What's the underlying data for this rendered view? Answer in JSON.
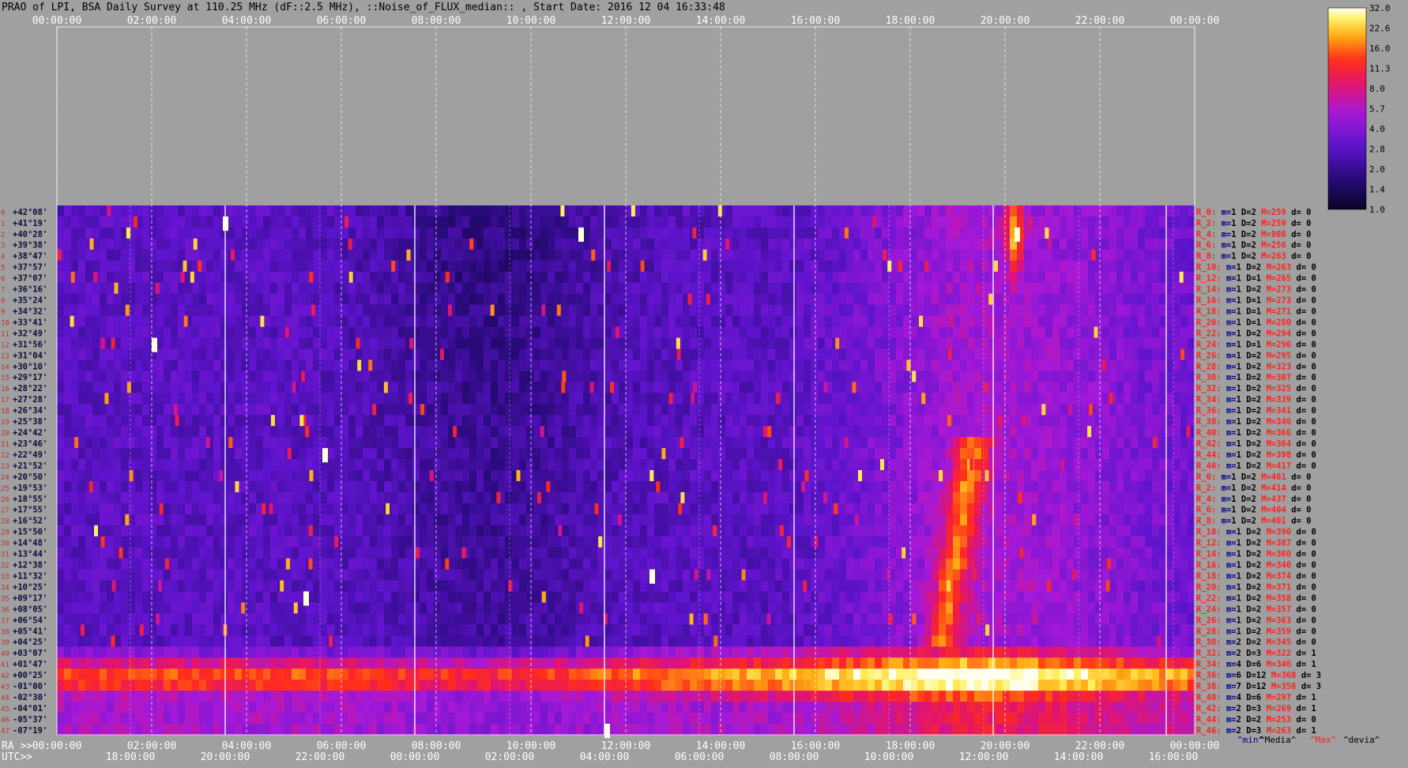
{
  "title": "PRAO of LPI, BSA Daily Survey at 110.25 MHz (dF::2.5 MHz), ::Noise_of_FLUX_median:: , Start Date: 2016 12 04 16:33:48",
  "chart_data": {
    "type": "heatmap",
    "title": "PRAO of LPI, BSA Daily Survey at 110.25 MHz (dF::2.5 MHz), ::Noise_of_FLUX_median:: , Start Date: 2016 12 04 16:33:48",
    "ra_axis_label": "RA >>",
    "utc_axis_label": "UTC>>",
    "ra_ticks_top": [
      "00:00:00",
      "02:00:00",
      "04:00:00",
      "06:00:00",
      "08:00:00",
      "10:00:00",
      "12:00:00",
      "14:00:00",
      "16:00:00",
      "18:00:00",
      "20:00:00",
      "22:00:00",
      "00:00:00"
    ],
    "ra_ticks_bottom": [
      "00:00:00",
      "02:00:00",
      "04:00:00",
      "06:00:00",
      "08:00:00",
      "10:00:00",
      "12:00:00",
      "14:00:00",
      "16:00:00",
      "18:00:00",
      "20:00:00",
      "22:00:00",
      "00:00:00"
    ],
    "utc_ticks": [
      "18:00:00",
      "20:00:00",
      "22:00:00",
      "00:00:00",
      "02:00:00",
      "04:00:00",
      "06:00:00",
      "08:00:00",
      "10:00:00",
      "12:00:00",
      "14:00:00",
      "16:00:00"
    ],
    "row_numbers": [
      "0",
      "1",
      "2",
      "3",
      "4",
      "5",
      "6",
      "7",
      "8",
      "9",
      "10",
      "11",
      "12",
      "13",
      "14",
      "15",
      "16",
      "17",
      "18",
      "19",
      "20",
      "21",
      "22",
      "23",
      "24",
      "25",
      "26",
      "27",
      "28",
      "29",
      "30",
      "31",
      "32",
      "33",
      "34",
      "35",
      "36",
      "37",
      "38",
      "39",
      "40",
      "41",
      "42",
      "43",
      "44",
      "45",
      "46",
      "47",
      "0",
      "1",
      "2",
      "3",
      "4",
      "5",
      "6",
      "7",
      "8",
      "9",
      "10",
      "11",
      "12",
      "13",
      "14",
      "15",
      "16",
      "17",
      "18",
      "19",
      "20",
      "21",
      "22",
      "23",
      "24",
      "25",
      "26",
      "27",
      "28",
      "29",
      "30",
      "31",
      "32",
      "33",
      "34",
      "35",
      "36",
      "37",
      "38",
      "39",
      "40",
      "41",
      "42",
      "43",
      "44",
      "45",
      "46",
      "47"
    ],
    "declinations": [
      "+42°08'",
      "+41°19'",
      "+40°28'",
      "+39°38'",
      "+38°47'",
      "+37°57'",
      "+37°07'",
      "+36°16'",
      "+35°24'",
      "+34°32'",
      "+33°41'",
      "+32°49'",
      "+31°56'",
      "+31°04'",
      "+30°10'",
      "+29°17'",
      "+28°22'",
      "+27°28'",
      "+26°34'",
      "+25°38'",
      "+24°42'",
      "+23°46'",
      "+22°49'",
      "+21°52'",
      "+20°50'",
      "+19°53'",
      "+18°55'",
      "+17°55'",
      "+16°52'",
      "+15°50'",
      "+14°48'",
      "+13°44'",
      "+12°38'",
      "+11°32'",
      "+10°25'",
      "+09°17'",
      "+08°05'",
      "+06°54'",
      "+05°41'",
      "+04°25'",
      "+03°07'",
      "+01°47'",
      "+00°25'",
      "-01°00'",
      "-02°30'",
      "-04°01'",
      "-05°37'",
      "-07°19'"
    ],
    "beam_stats": [
      {
        "beam": "R_0:",
        "m": "1",
        "D": "2",
        "M": "259",
        "d": "0"
      },
      {
        "beam": "R_2:",
        "m": "1",
        "D": "2",
        "M": "259",
        "d": "0"
      },
      {
        "beam": "R_4:",
        "m": "1",
        "D": "2",
        "M": "908",
        "d": "0"
      },
      {
        "beam": "R_6:",
        "m": "1",
        "D": "2",
        "M": "256",
        "d": "0"
      },
      {
        "beam": "R_8:",
        "m": "1",
        "D": "2",
        "M": "263",
        "d": "0"
      },
      {
        "beam": "R_10:",
        "m": "1",
        "D": "2",
        "M": "263",
        "d": "0"
      },
      {
        "beam": "R_12:",
        "m": "1",
        "D": "1",
        "M": "265",
        "d": "0"
      },
      {
        "beam": "R_14:",
        "m": "1",
        "D": "2",
        "M": "273",
        "d": "0"
      },
      {
        "beam": "R_16:",
        "m": "1",
        "D": "1",
        "M": "273",
        "d": "0"
      },
      {
        "beam": "R_18:",
        "m": "1",
        "D": "1",
        "M": "271",
        "d": "0"
      },
      {
        "beam": "R_20:",
        "m": "1",
        "D": "1",
        "M": "280",
        "d": "0"
      },
      {
        "beam": "R_22:",
        "m": "1",
        "D": "2",
        "M": "294",
        "d": "0"
      },
      {
        "beam": "R_24:",
        "m": "1",
        "D": "1",
        "M": "296",
        "d": "0"
      },
      {
        "beam": "R_26:",
        "m": "1",
        "D": "2",
        "M": "295",
        "d": "0"
      },
      {
        "beam": "R_28:",
        "m": "1",
        "D": "2",
        "M": "323",
        "d": "0"
      },
      {
        "beam": "R_30:",
        "m": "1",
        "D": "2",
        "M": "307",
        "d": "0"
      },
      {
        "beam": "R_32:",
        "m": "1",
        "D": "2",
        "M": "325",
        "d": "0"
      },
      {
        "beam": "R_34:",
        "m": "1",
        "D": "2",
        "M": "339",
        "d": "0"
      },
      {
        "beam": "R_36:",
        "m": "1",
        "D": "2",
        "M": "341",
        "d": "0"
      },
      {
        "beam": "R_38:",
        "m": "1",
        "D": "2",
        "M": "346",
        "d": "0"
      },
      {
        "beam": "R_40:",
        "m": "1",
        "D": "2",
        "M": "366",
        "d": "0"
      },
      {
        "beam": "R_42:",
        "m": "1",
        "D": "2",
        "M": "364",
        "d": "0"
      },
      {
        "beam": "R_44:",
        "m": "1",
        "D": "2",
        "M": "398",
        "d": "0"
      },
      {
        "beam": "R_46:",
        "m": "1",
        "D": "2",
        "M": "417",
        "d": "0"
      },
      {
        "beam": "R_0:",
        "m": "1",
        "D": "2",
        "M": "401",
        "d": "0"
      },
      {
        "beam": "R_2:",
        "m": "1",
        "D": "2",
        "M": "414",
        "d": "0"
      },
      {
        "beam": "R_4:",
        "m": "1",
        "D": "2",
        "M": "437",
        "d": "0"
      },
      {
        "beam": "R_6:",
        "m": "1",
        "D": "2",
        "M": "404",
        "d": "0"
      },
      {
        "beam": "R_8:",
        "m": "1",
        "D": "2",
        "M": "401",
        "d": "0"
      },
      {
        "beam": "R_10:",
        "m": "1",
        "D": "2",
        "M": "390",
        "d": "0"
      },
      {
        "beam": "R_12:",
        "m": "1",
        "D": "2",
        "M": "387",
        "d": "0"
      },
      {
        "beam": "R_14:",
        "m": "1",
        "D": "2",
        "M": "360",
        "d": "0"
      },
      {
        "beam": "R_16:",
        "m": "1",
        "D": "2",
        "M": "340",
        "d": "0"
      },
      {
        "beam": "R_18:",
        "m": "1",
        "D": "2",
        "M": "374",
        "d": "0"
      },
      {
        "beam": "R_20:",
        "m": "1",
        "D": "2",
        "M": "371",
        "d": "0"
      },
      {
        "beam": "R_22:",
        "m": "1",
        "D": "2",
        "M": "358",
        "d": "0"
      },
      {
        "beam": "R_24:",
        "m": "1",
        "D": "2",
        "M": "357",
        "d": "0"
      },
      {
        "beam": "R_26:",
        "m": "1",
        "D": "2",
        "M": "363",
        "d": "0"
      },
      {
        "beam": "R_28:",
        "m": "1",
        "D": "2",
        "M": "359",
        "d": "0"
      },
      {
        "beam": "R_30:",
        "m": "2",
        "D": "2",
        "M": "345",
        "d": "0"
      },
      {
        "beam": "R_32:",
        "m": "2",
        "D": "3",
        "M": "322",
        "d": "1"
      },
      {
        "beam": "R_34:",
        "m": "4",
        "D": "6",
        "M": "346",
        "d": "1"
      },
      {
        "beam": "R_36:",
        "m": "6",
        "D": "12",
        "M": "368",
        "d": "3"
      },
      {
        "beam": "R_38:",
        "m": "7",
        "D": "12",
        "M": "358",
        "d": "3"
      },
      {
        "beam": "R_40:",
        "m": "4",
        "D": "6",
        "M": "297",
        "d": "1"
      },
      {
        "beam": "R_42:",
        "m": "2",
        "D": "3",
        "M": "269",
        "d": "1"
      },
      {
        "beam": "R_44:",
        "m": "2",
        "D": "2",
        "M": "253",
        "d": "0"
      },
      {
        "beam": "R_46:",
        "m": "2",
        "D": "3",
        "M": "263",
        "d": "1"
      }
    ],
    "stat_legend": [
      "^min^",
      "^Media^",
      "^Max^",
      "^devia^"
    ],
    "colorbar_ticks": [
      "32.0",
      "22.6",
      "16.0",
      "11.3",
      "8.0",
      "5.7",
      "4.0",
      "2.8",
      "2.0",
      "1.4",
      "1.0"
    ],
    "colorbar_scale": "log",
    "colors": {
      "background": "#a0a0a0",
      "panel_low": "#0c0730",
      "row_number": "#c03030",
      "stat_label": "#ff2020",
      "stat_value": "#000000",
      "legend_min": "#00008b",
      "legend_media": "#000000",
      "legend_max": "#ff2020",
      "legend_devia": "#000000"
    }
  }
}
